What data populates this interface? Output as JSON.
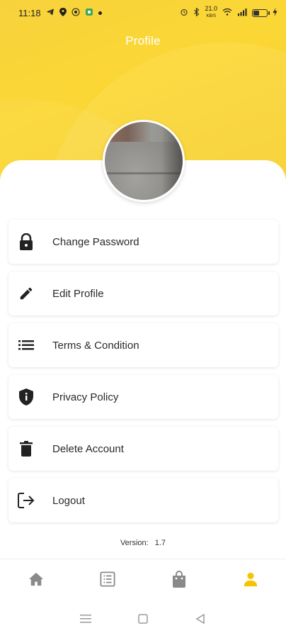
{
  "status_bar": {
    "time": "11:18",
    "speed": "21.0",
    "speed_unit": "KB/S"
  },
  "header": {
    "title": "Profile",
    "background_color": "#f8d334"
  },
  "menu": {
    "items": [
      {
        "label": "Change Password",
        "icon": "lock-icon"
      },
      {
        "label": "Edit Profile",
        "icon": "pencil-icon"
      },
      {
        "label": "Terms & Condition",
        "icon": "list-icon"
      },
      {
        "label": "Privacy Policy",
        "icon": "shield-icon"
      },
      {
        "label": "Delete Account",
        "icon": "trash-icon"
      },
      {
        "label": "Logout",
        "icon": "logout-icon"
      }
    ]
  },
  "version": {
    "label": "Version:",
    "value": "1.7"
  },
  "bottom_nav": {
    "items": [
      {
        "name": "home-icon",
        "active": false
      },
      {
        "name": "list-icon",
        "active": false
      },
      {
        "name": "shopping-bag-icon",
        "active": false
      },
      {
        "name": "person-icon",
        "active": true
      }
    ],
    "active_color": "#f5c400",
    "inactive_color": "#8a8a8a"
  }
}
